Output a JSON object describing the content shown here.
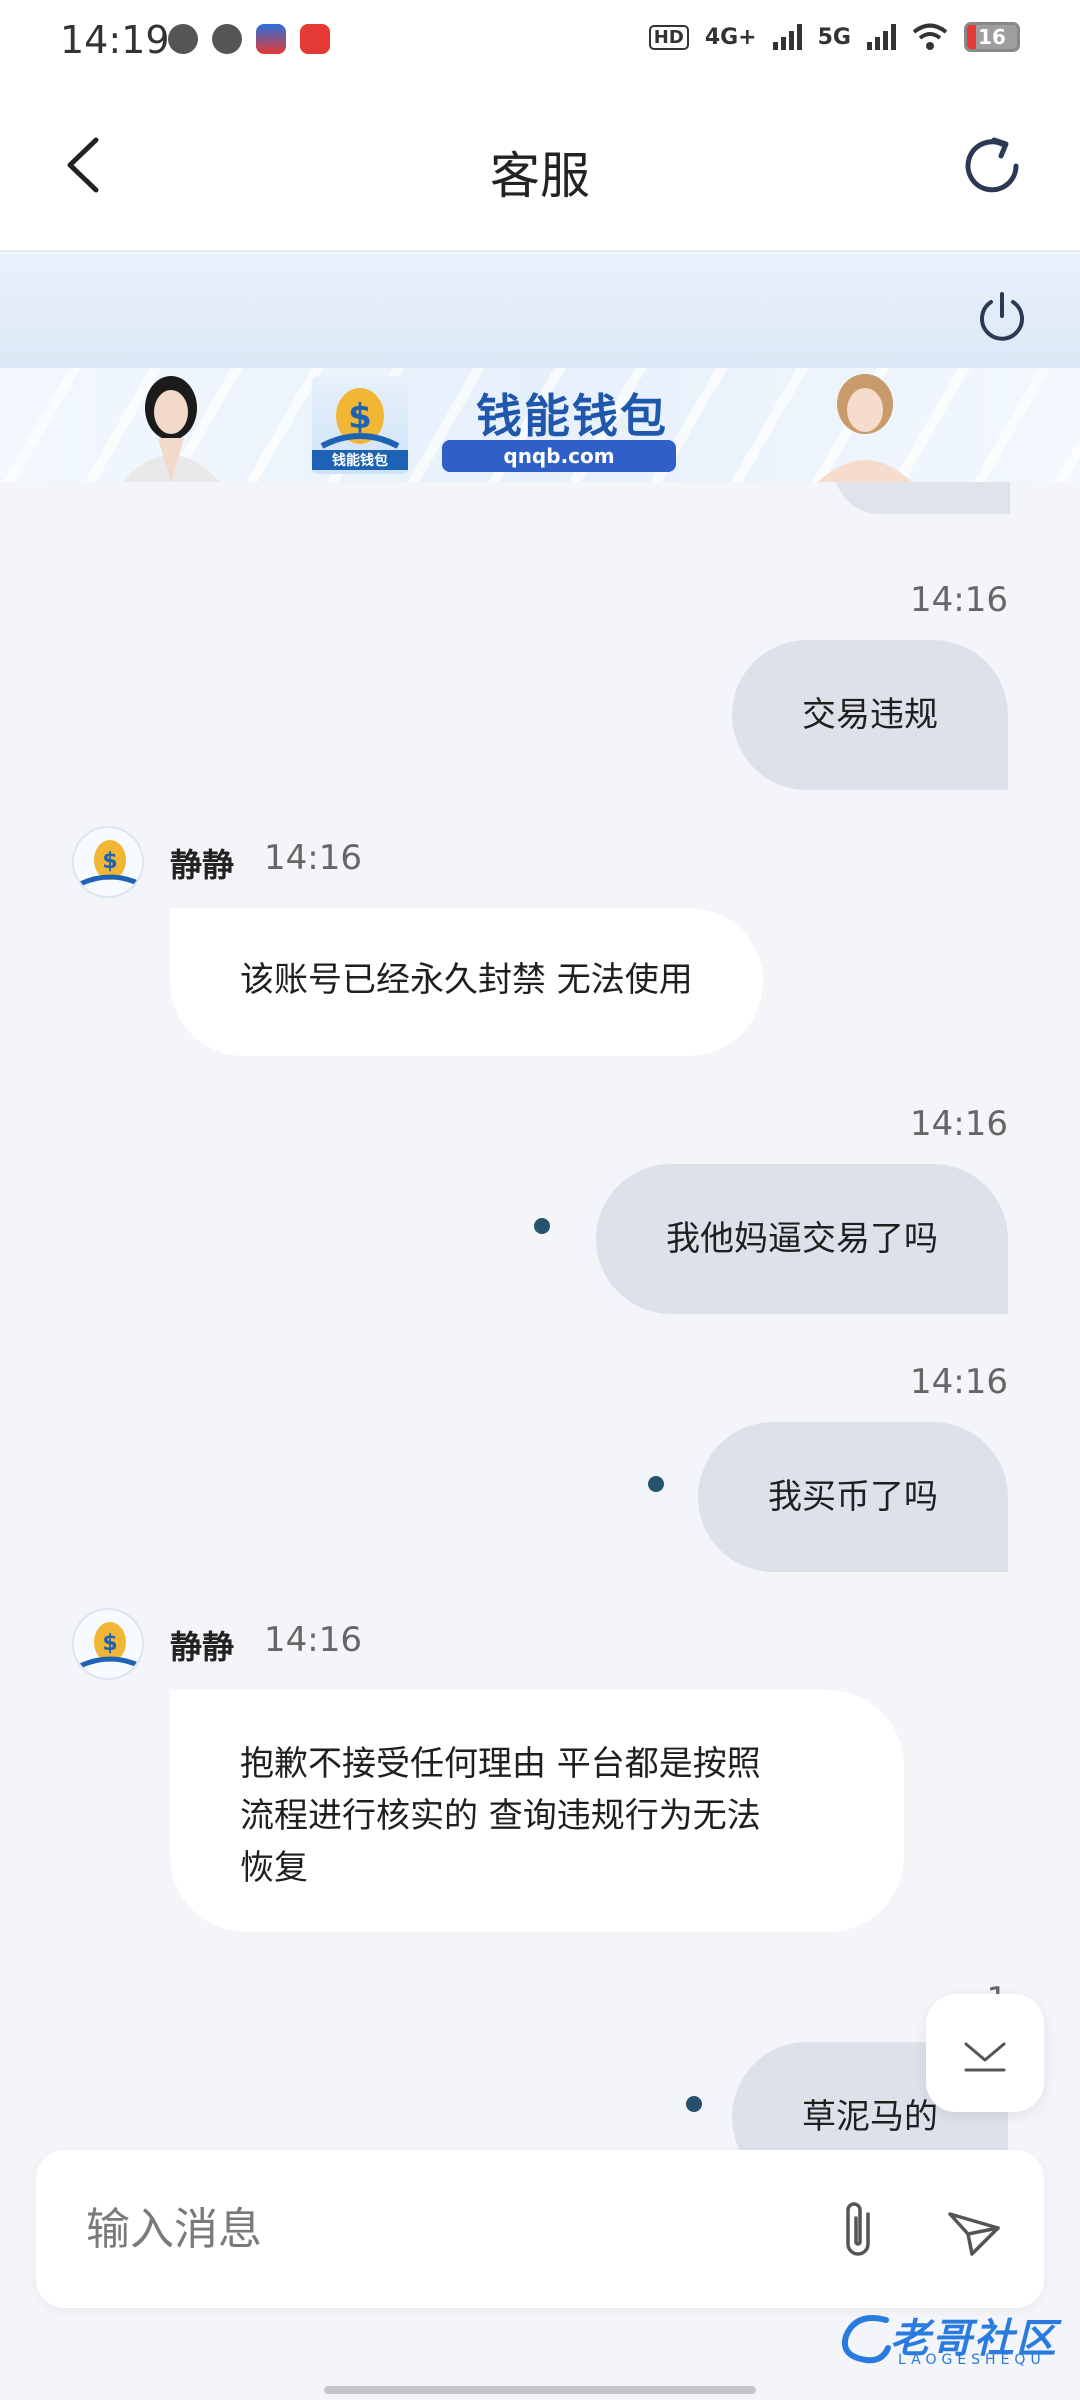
{
  "status_bar": {
    "time": "14:19",
    "network_1": "4G+",
    "network_2": "5G",
    "hd_label": "HD",
    "battery": "16",
    "notification_icons": [
      "message-bubble-icon",
      "chat-icon",
      "app-icon",
      "red-app-icon"
    ]
  },
  "header": {
    "title": "客服",
    "back_icon": "chevron-left-icon",
    "refresh_icon": "refresh-icon"
  },
  "ad_banner": {
    "brand": "钱能钱包",
    "url": "qnqb.com",
    "logo_text": "钱能钱包"
  },
  "chat": {
    "messages": [
      {
        "direction": "out",
        "time": "14:16",
        "text": "交易违规",
        "unread_dot": false
      },
      {
        "direction": "in",
        "sender": "静静",
        "time": "14:16",
        "text": "该账号已经永久封禁 无法使用"
      },
      {
        "direction": "out",
        "time": "14:16",
        "text": "我他妈逼交易了吗",
        "unread_dot": true
      },
      {
        "direction": "out",
        "time": "14:16",
        "text": "我买币了吗",
        "unread_dot": true
      },
      {
        "direction": "in",
        "sender": "静静",
        "time": "14:16",
        "text_lines": [
          "抱歉不接受任何理由 平台都是按照",
          "流程进行核实的 查询违规行为无法",
          "恢复"
        ]
      },
      {
        "direction": "out",
        "time": "1",
        "text": "草泥马的",
        "unread_dot": true
      }
    ]
  },
  "input": {
    "placeholder": "输入消息",
    "attach_icon": "paperclip-icon",
    "send_icon": "send-icon"
  },
  "watermark": {
    "text": "老哥社区",
    "sub": "LAOGESHEQU"
  },
  "colors": {
    "outgoing_bubble": "#dde2ea",
    "incoming_bubble": "#ffffff",
    "background": "#f3f5f8",
    "unread_dot": "#26516f"
  }
}
